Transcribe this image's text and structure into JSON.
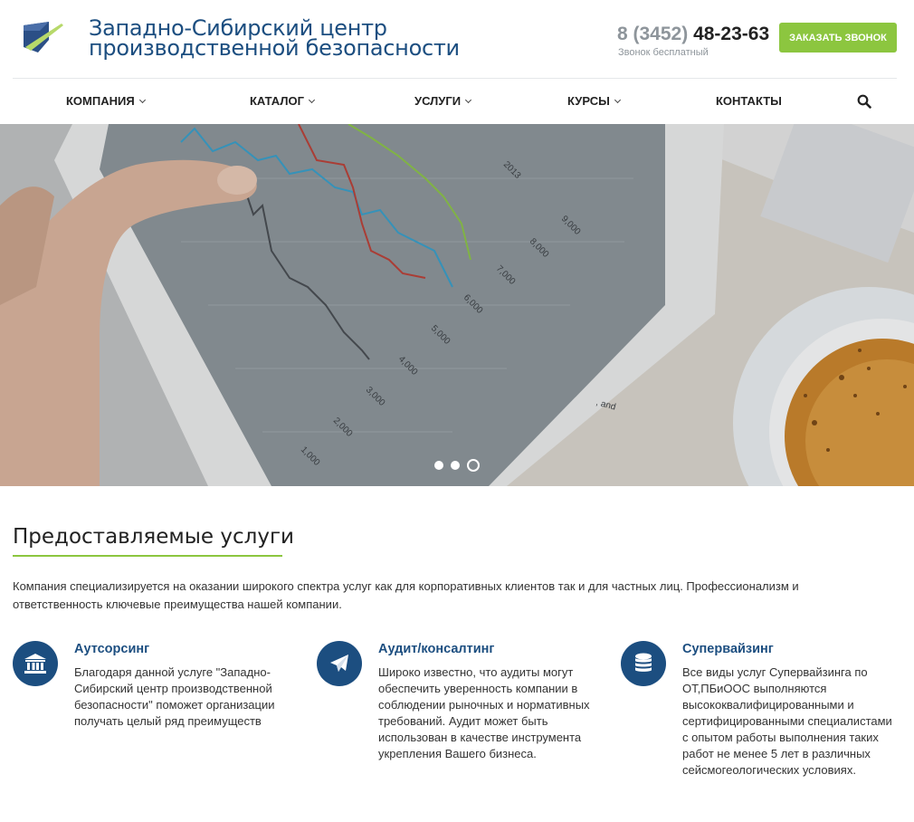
{
  "header": {
    "brand_line1": "Западно-Сибирский центр",
    "brand_line2": "производственной безопасности",
    "phone_code": "8 (3452)",
    "phone_number": "48-23-63",
    "phone_note": "Звонок бесплатный",
    "callback_label": "Заказать звонок"
  },
  "nav": {
    "items": [
      {
        "label": "Компания",
        "has_dropdown": true
      },
      {
        "label": "Каталог",
        "has_dropdown": true
      },
      {
        "label": "Услуги",
        "has_dropdown": true
      },
      {
        "label": "Курсы",
        "has_dropdown": true
      },
      {
        "label": "Контакты",
        "has_dropdown": false
      }
    ],
    "search_icon": "search-icon"
  },
  "hero": {
    "slide_count": 3,
    "active_slide": 3
  },
  "services": {
    "title": "Предоставляемые услуги",
    "intro": "Компания специализируется на оказании широкого спектра услуг как для корпоративных клиентов так и для частных лиц. Профессионализм и ответственность ключевые преимущества нашей компании.",
    "items": [
      {
        "icon": "bank-icon",
        "title": "Аутсорсинг",
        "text": "Благодаря данной услуге \"Западно-Сибирский центр производственной безопасности\" поможет организации получать целый ряд преимуществ"
      },
      {
        "icon": "paper-plane-icon",
        "title": "Аудит/консалтинг",
        "text": "Широко известно, что аудиты могут обеспечить уверенность компании в соблюдении рыночных и нормативных требований. Аудит может быть использован в качестве инструмента укрепления Вашего бизнеса."
      },
      {
        "icon": "database-icon",
        "title": "Супервайзинг",
        "text": "Все виды услуг Супервайзинга по ОТ,ПБиООС выполняются высококвалифицированными и сертифицированными специалистами с опытом работы выполнения таких работ не менее 5 лет в различных сейсмогеологических условиях."
      }
    ]
  },
  "colors": {
    "brand_blue": "#1c4e80",
    "accent_green": "#8cc63f"
  }
}
